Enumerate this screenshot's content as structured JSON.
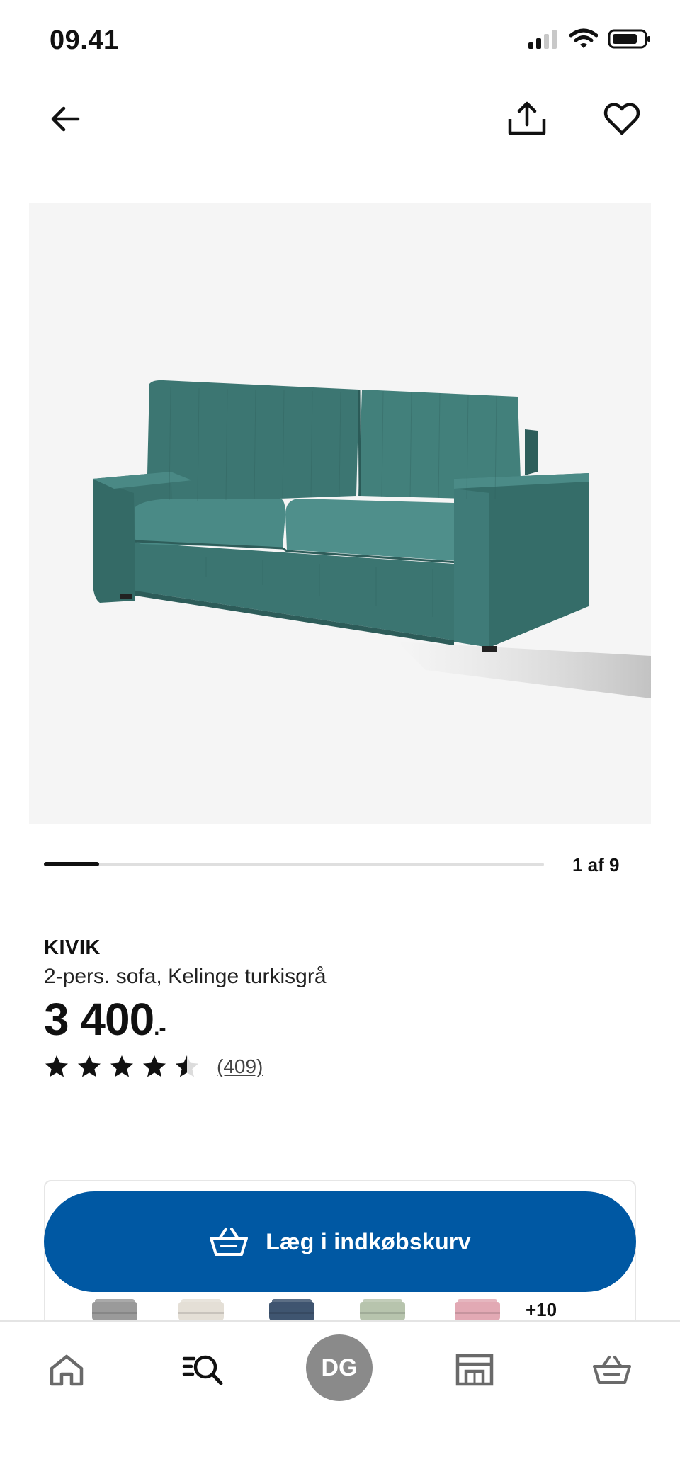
{
  "status": {
    "time": "09.41"
  },
  "header": {
    "back_icon": "arrow-left-icon",
    "share_icon": "share-icon",
    "favorite_icon": "heart-icon"
  },
  "product": {
    "image_icon": "sofa-image",
    "sofa_color": "#3f7b78",
    "pager": {
      "text": "1 af 9",
      "current": 1,
      "total": 9
    },
    "name": "KIVIK",
    "description": "2-pers. sofa, Kelinge turkisgrå",
    "price": "3 400",
    "price_suffix": ".-",
    "rating": 4.5,
    "review_count": "(409)"
  },
  "cart": {
    "label": "Læg i indkøbskurv",
    "icon": "basket-icon",
    "color": "#0058a3"
  },
  "variants": {
    "swatch_colors": [
      "#9a9a9a",
      "#e4dfd6",
      "#3f5570",
      "#b7c4ad",
      "#e2a9b4"
    ],
    "more": "+10"
  },
  "nav": {
    "items": [
      "home-icon",
      "search-icon",
      "profile-avatar",
      "store-icon",
      "basket-icon"
    ],
    "profile_initials": "DG"
  }
}
